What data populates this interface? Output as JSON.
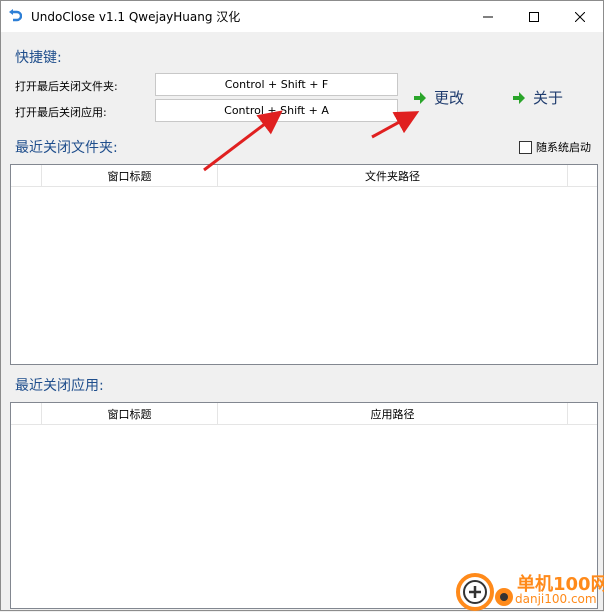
{
  "window": {
    "title": "UndoClose v1.1  QwejayHuang 汉化",
    "controls": {
      "minimize": "minimize",
      "maximize": "maximize",
      "close": "close"
    }
  },
  "shortcuts": {
    "heading": "快捷键:",
    "folder_label": "打开最后关闭文件夹:",
    "folder_hotkey": "Control + Shift + F",
    "app_label": "打开最后关闭应用:",
    "app_hotkey": "Control + Shift + A",
    "change_button": "更改",
    "about_button": "关于"
  },
  "recent_folders": {
    "heading": "最近关闭文件夹:",
    "autostart_label": "随系统启动",
    "autostart_checked": false,
    "columns": [
      "窗口标题",
      "文件夹路径"
    ],
    "rows": []
  },
  "recent_apps": {
    "heading": "最近关闭应用:",
    "columns": [
      "窗口标题",
      "应用路径"
    ],
    "rows": []
  },
  "watermark": {
    "site_name": "单机100网",
    "site_url": "danji100.com"
  },
  "colors": {
    "heading": "#1f4e8c",
    "arrow_red": "#e02020",
    "arrow_green": "#2aa52a",
    "watermark": "#ff8a1a"
  }
}
